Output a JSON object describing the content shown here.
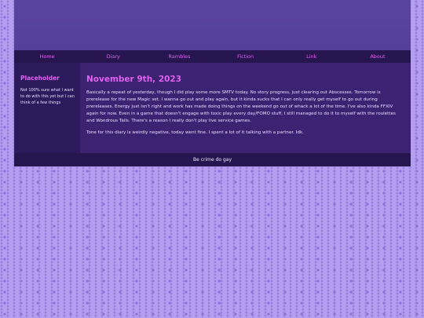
{
  "nav": {
    "items": [
      {
        "label": "Home"
      },
      {
        "label": "Diary"
      },
      {
        "label": "Rambles"
      },
      {
        "label": "Fiction"
      },
      {
        "label": "Link"
      },
      {
        "label": "About"
      }
    ]
  },
  "sidebar": {
    "title": "Placeholder",
    "text": "Not 100% sure what I want to do with this yet but I can think of a few things"
  },
  "post": {
    "title": "November 9th, 2023",
    "paragraphs": [
      "Basically a repeat of yesterday, though I did play some more SMTV today. No story progress, just clearing out Abscesses. Tomorrow is prerelease for the new Magic set. I wanna go out and play again, but it kinda sucks that I can only really get myself to go out during prereleases. Energy just isn't right and work has made doing things on the weekend go out of whack a lot of the time. I've also kinda FFXIV again for now. Even in a game that doesn't engage with toxic play every day/FOMO stuff, I still managed to do it to myself with the roulettes and Wondrous Tails. There's a reason I really don't play live service games.",
      "Tone for this diary is weirdly negative, today went fine. I spent a lot of it talking with a partner. Idk."
    ]
  },
  "footer": {
    "text": "Be crime do gay"
  },
  "colors": {
    "accent": "#e060f0",
    "nav_bg": "#26154f",
    "page_bg": "#b59df0"
  }
}
